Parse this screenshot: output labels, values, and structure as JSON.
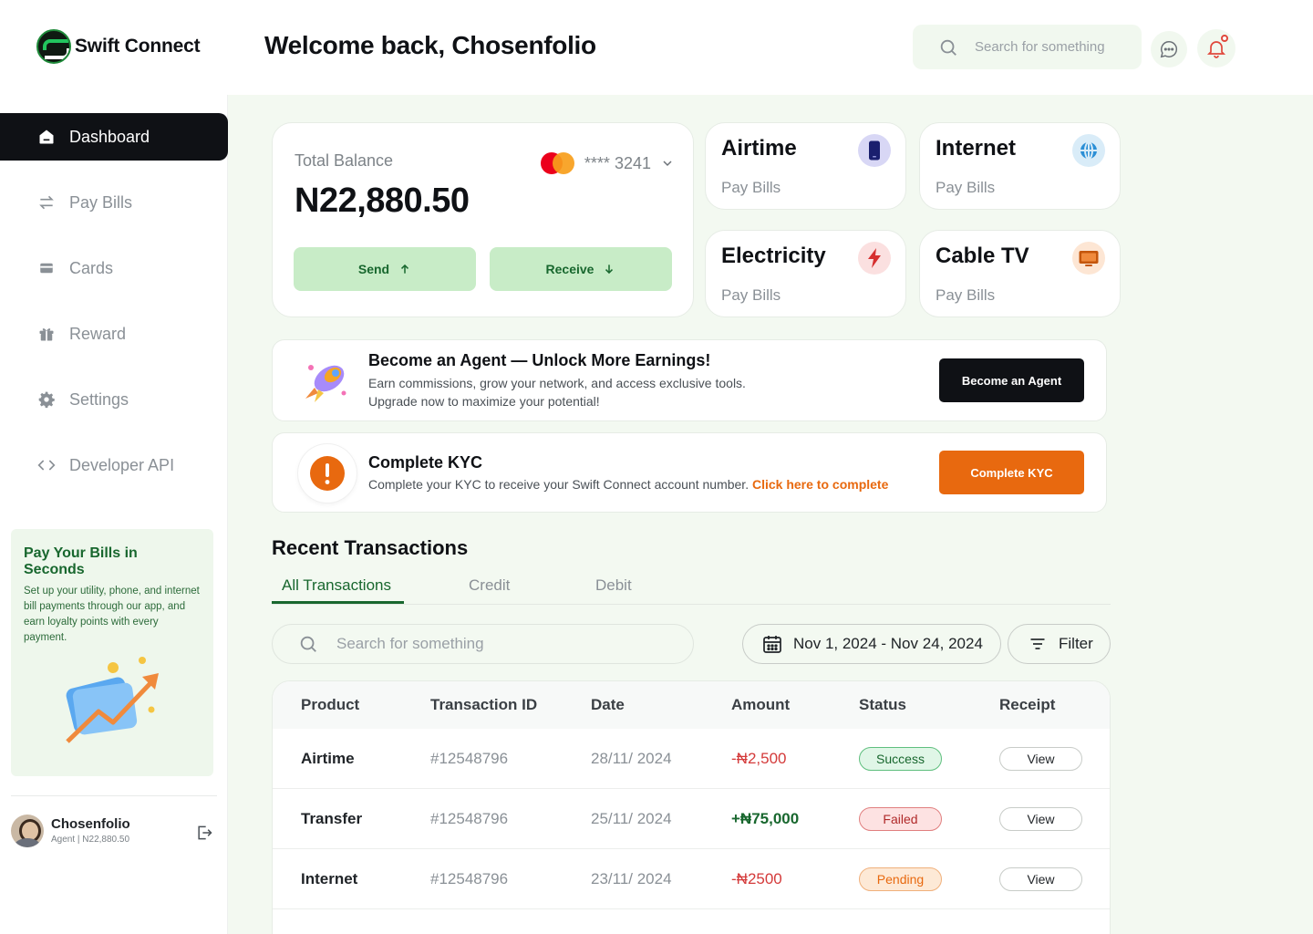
{
  "brand": {
    "name": "Swift Connect"
  },
  "header": {
    "welcome": "Welcome back, Chosenfolio",
    "search_placeholder": "Search for something"
  },
  "sidebar": {
    "items": [
      {
        "label": "Dashboard",
        "icon": "home-icon",
        "active": true
      },
      {
        "label": "Pay Bills",
        "icon": "transfer-arrows-icon"
      },
      {
        "label": "Cards",
        "icon": "card-icon"
      },
      {
        "label": "Reward",
        "icon": "gift-icon"
      },
      {
        "label": "Settings",
        "icon": "gear-icon"
      },
      {
        "label": "Developer API",
        "icon": "code-icon"
      }
    ],
    "promo": {
      "title": "Pay Your Bills in Seconds",
      "text": "Set up your utility, phone, and internet bill payments through our app, and earn loyalty points with every payment."
    },
    "profile": {
      "name": "Chosenfolio",
      "role": "Agent",
      "balance": "N22,880.50"
    }
  },
  "balance": {
    "label": "Total Balance",
    "amount": "N22,880.50",
    "card_mask": "**** 3241",
    "send_label": "Send",
    "receive_label": "Receive"
  },
  "bills": [
    {
      "title": "Airtime",
      "sub": "Pay Bills",
      "icon": "phone-icon",
      "color": "#d8d7f5"
    },
    {
      "title": "Internet",
      "sub": "Pay Bills",
      "icon": "globe-icon",
      "color": "#d9ecf8"
    },
    {
      "title": "Electricity",
      "sub": "Pay Bills",
      "icon": "lightning-icon",
      "color": "#fbe0e0"
    },
    {
      "title": "Cable TV",
      "sub": "Pay Bills",
      "icon": "tv-icon",
      "color": "#fde6d4"
    }
  ],
  "agent_banner": {
    "title": "Become an Agent — Unlock More Earnings!",
    "line1": "Earn commissions, grow your network, and access exclusive tools.",
    "line2": "Upgrade now to maximize your potential!",
    "button": "Become an Agent"
  },
  "kyc_banner": {
    "title": "Complete KYC",
    "text": "Complete your KYC to receive your Swift Connect account number.",
    "link": "Click here to complete",
    "button": "Complete KYC"
  },
  "transactions": {
    "title": "Recent Transactions",
    "tabs": [
      "All Transactions",
      "Credit",
      "Debit"
    ],
    "search_placeholder": "Search for something",
    "date_range": "Nov 1, 2024 - Nov 24, 2024",
    "filter_label": "Filter",
    "columns": [
      "Product",
      "Transaction ID",
      "Date",
      "Amount",
      "Status",
      "Receipt"
    ],
    "rows": [
      {
        "product": "Airtime",
        "id": "#12548796",
        "date": "28/11/ 2024",
        "amount": "-₦2,500",
        "status": "Success",
        "receipt": "View"
      },
      {
        "product": "Transfer",
        "id": "#12548796",
        "date": "25/11/ 2024",
        "amount": "+₦75,000",
        "status": "Failed",
        "receipt": "View"
      },
      {
        "product": "Internet",
        "id": "#12548796",
        "date": "23/11/ 2024",
        "amount": "-₦2500",
        "status": "Pending",
        "receipt": "View"
      }
    ]
  }
}
